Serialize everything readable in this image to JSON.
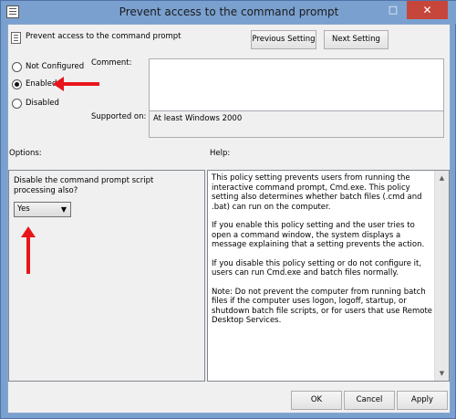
{
  "window": {
    "title": "Prevent access to the command prompt",
    "maximize_glyph": "□",
    "close_glyph": "✕"
  },
  "header": {
    "title": "Prevent access to the command prompt"
  },
  "nav": {
    "previous_label": "Previous Setting",
    "next_label": "Next Setting"
  },
  "state": {
    "options": [
      {
        "label": "Not Configured",
        "selected": false
      },
      {
        "label": "Enabled",
        "selected": true
      },
      {
        "label": "Disabled",
        "selected": false
      }
    ]
  },
  "comment": {
    "label": "Comment:",
    "value": ""
  },
  "supported": {
    "label": "Supported on:",
    "value": "At least Windows 2000"
  },
  "options_section": {
    "label": "Options:",
    "prompt": "Disable the command prompt script processing also?",
    "select_value": "Yes"
  },
  "help_section": {
    "label": "Help:",
    "paragraphs": [
      "This policy setting prevents users from running the interactive command prompt, Cmd.exe.  This policy setting also determines whether batch files (.cmd and .bat) can run on the computer.",
      "If you enable this policy setting and the user tries to open a command window, the system displays a message explaining that a setting prevents the action.",
      "If you disable this policy setting or do not configure it, users can run Cmd.exe and batch files normally.",
      "Note: Do not prevent the computer from running batch files if the computer uses logon, logoff, startup, or shutdown batch file scripts, or for users that use Remote Desktop Services."
    ]
  },
  "footer": {
    "ok_label": "OK",
    "cancel_label": "Cancel",
    "apply_label": "Apply"
  },
  "colors": {
    "annotation_arrow": "#e8151b",
    "title_bar": "#7aa0cf",
    "close_button": "#c7463b"
  }
}
